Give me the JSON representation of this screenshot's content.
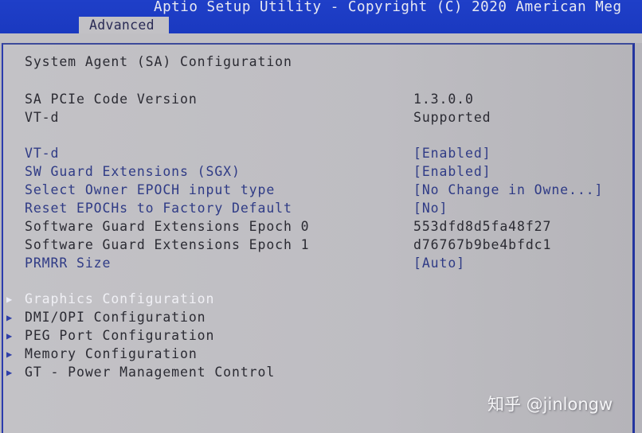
{
  "header": {
    "title": "Aptio Setup Utility - Copyright (C) 2020 American Meg",
    "active_tab": "Advanced"
  },
  "page": {
    "section_title": "System Agent (SA) Configuration"
  },
  "info_rows": [
    {
      "label": "SA PCIe Code Version",
      "value": "1.3.0.0"
    },
    {
      "label": "VT-d",
      "value": "Supported"
    }
  ],
  "settings": [
    {
      "label": "VT-d",
      "value": "[Enabled]",
      "editable": true
    },
    {
      "label": "SW Guard Extensions (SGX)",
      "value": "[Enabled]",
      "editable": true
    },
    {
      "label": "Select Owner EPOCH input type",
      "value": "[No Change in Owne...]",
      "editable": true
    },
    {
      "label": "Reset EPOCHs to Factory Default",
      "value": "[No]",
      "editable": true
    },
    {
      "label": "Software Guard Extensions Epoch 0",
      "value": "553dfd8d5fa48f27",
      "editable": false
    },
    {
      "label": "Software Guard Extensions Epoch 1",
      "value": "d76767b9be4bfdc1",
      "editable": false
    },
    {
      "label": "PRMRR Size",
      "value": "[Auto]",
      "editable": true
    }
  ],
  "submenus": [
    {
      "label": "Graphics Configuration",
      "selected": true,
      "icon": "triangle-right-icon"
    },
    {
      "label": "DMI/OPI Configuration",
      "selected": false,
      "icon": "triangle-right-icon"
    },
    {
      "label": "PEG Port Configuration",
      "selected": false,
      "icon": "triangle-right-icon"
    },
    {
      "label": "Memory Configuration",
      "selected": false,
      "icon": "triangle-right-icon"
    },
    {
      "label": "GT - Power Management Control",
      "selected": false,
      "icon": "triangle-right-icon"
    }
  ],
  "watermark": "知乎 @jinlongw",
  "colors": {
    "header_bg": "#1f3fc8",
    "panel_bg": "#c0bfc3",
    "editable_text": "#2f3b86",
    "static_text": "#2b2b33",
    "selected_text": "#f0f0f5"
  }
}
